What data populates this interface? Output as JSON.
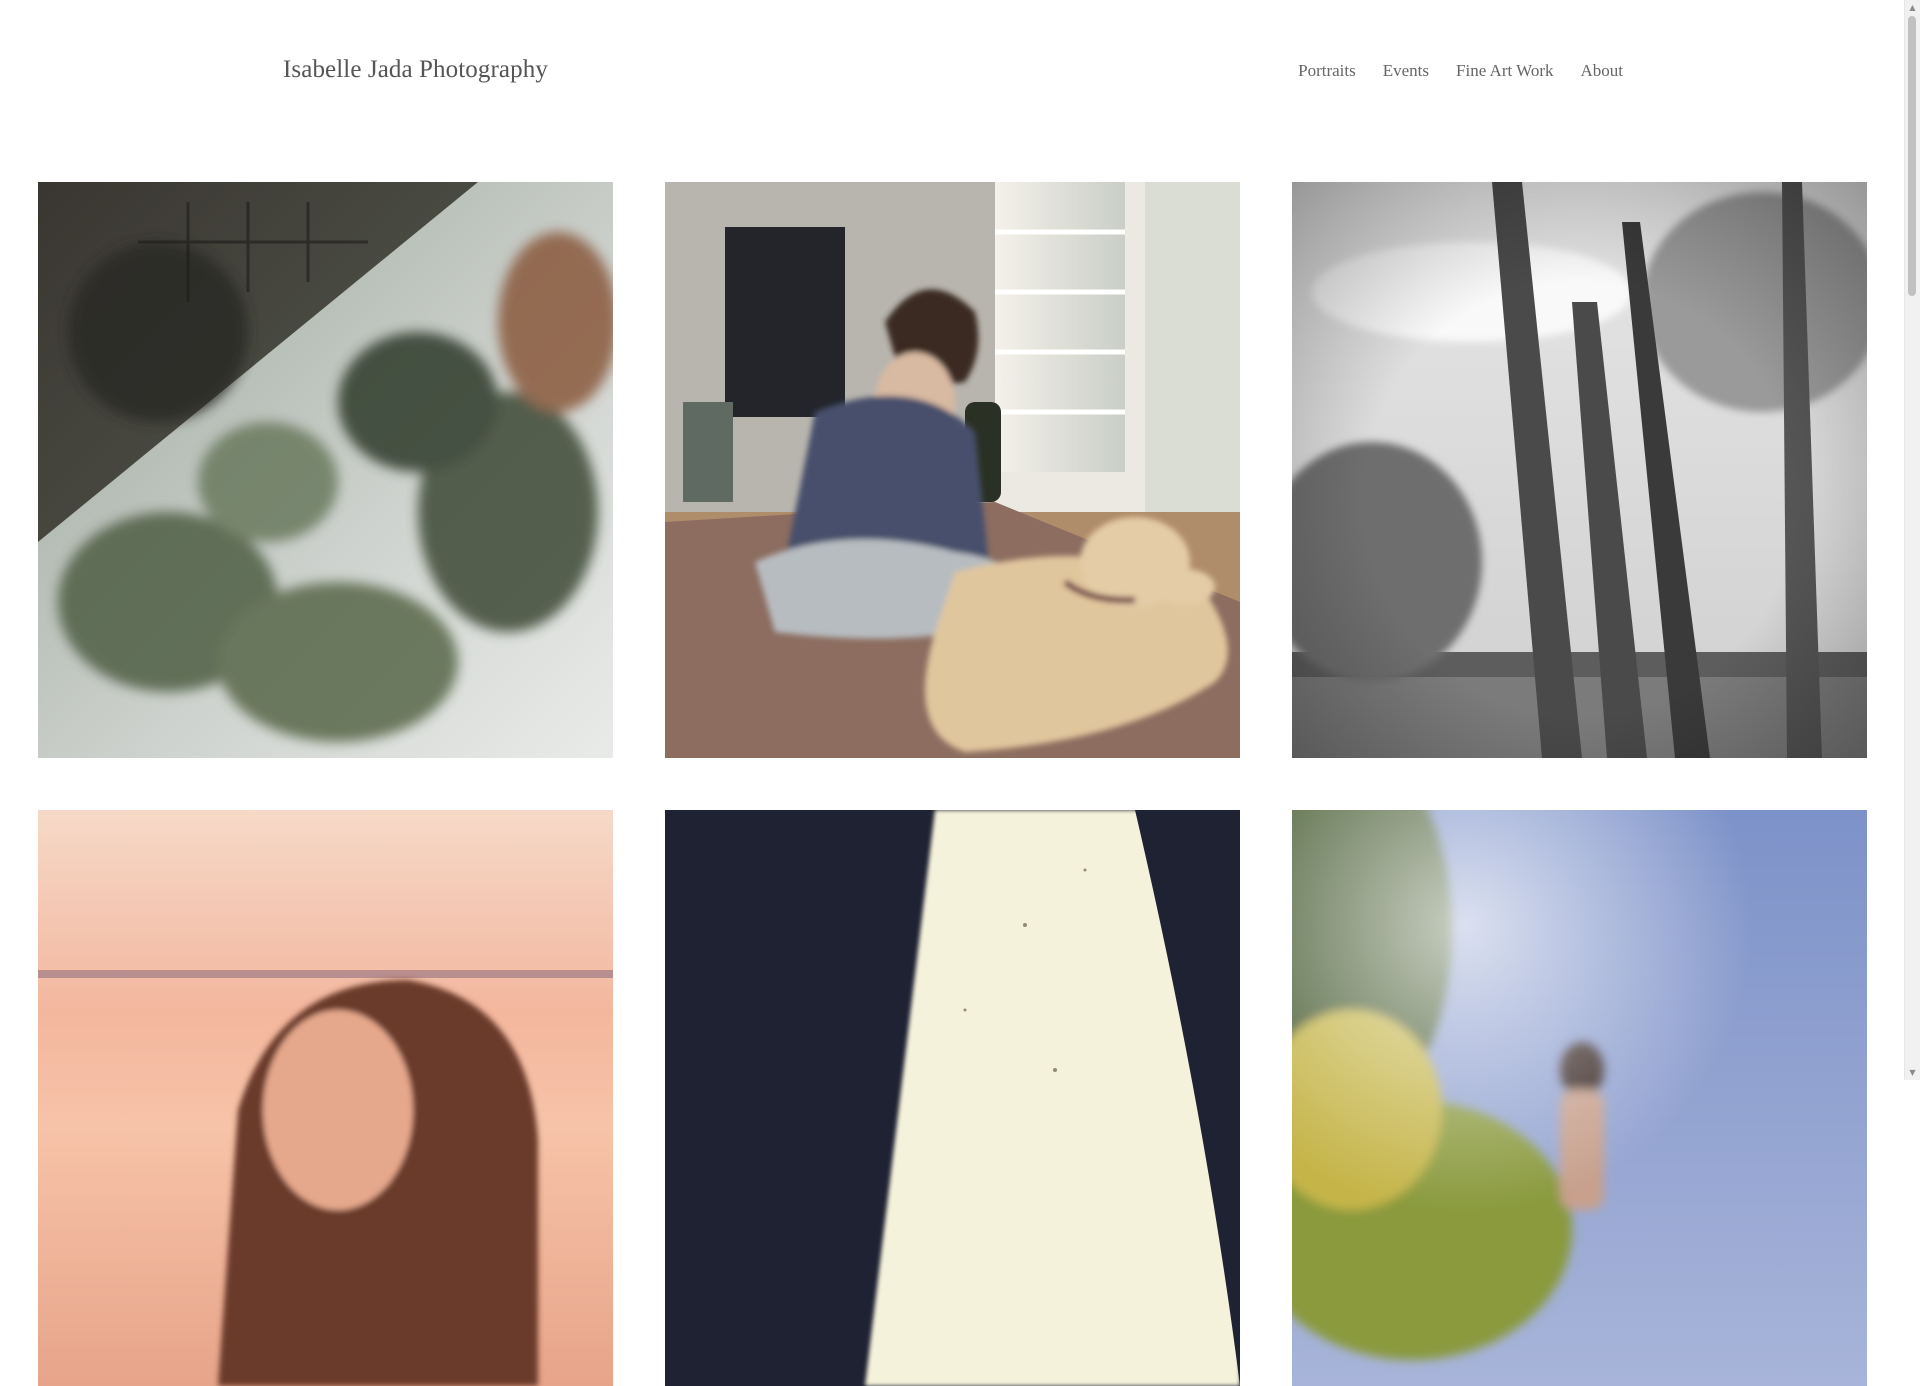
{
  "header": {
    "site_title": "Isabelle Jada Photography",
    "nav": [
      {
        "label": "Portraits"
      },
      {
        "label": "Events"
      },
      {
        "label": "Fine Art Work"
      },
      {
        "label": "About"
      }
    ]
  },
  "gallery": {
    "photos": [
      {
        "subject": "double exposure of trees and building"
      },
      {
        "subject": "person seated on rug with yellow dog by window"
      },
      {
        "subject": "black and white trees by the water"
      },
      {
        "subject": "woman at sunset by the water"
      },
      {
        "subject": "bright film frame with dark edges"
      },
      {
        "subject": "woman standing among tall plants under blue sky"
      }
    ]
  },
  "scrollbar": {
    "up_icon": "triangle-up",
    "down_icon": "triangle-down"
  }
}
